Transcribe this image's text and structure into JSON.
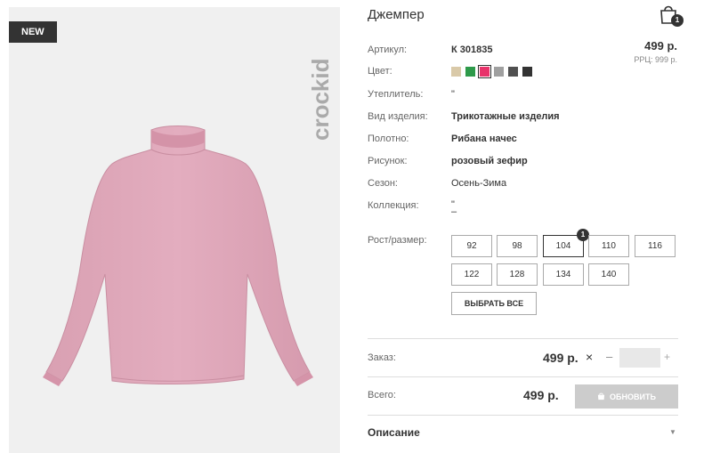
{
  "badge": "NEW",
  "brand": "crockid",
  "product": {
    "title": "Джемпер",
    "price": "499 р.",
    "rrp": "РРЦ: 999 р.",
    "cart_count": "1"
  },
  "attributes": {
    "article_label": "Артикул:",
    "article_value": "К 301835",
    "color_label": "Цвет:",
    "insulation_label": "Утеплитель:",
    "insulation_value": "\"",
    "type_label": "Вид изделия:",
    "type_value": "Трикотажные изделия",
    "fabric_label": "Полотно:",
    "fabric_value": "Рибана начес",
    "pattern_label": "Рисунок:",
    "pattern_value": "розовый зефир",
    "season_label": "Сезон:",
    "season_value": "Осень-Зима",
    "collection_label": "Коллекция:",
    "collection_value": "\"",
    "collection_value2": "–"
  },
  "colors": [
    "#d9c9a8",
    "#2e9a4a",
    "#e8336b",
    "#a0a0a0",
    "#505050",
    "#333333"
  ],
  "sizes": {
    "label": "Рост/размер:",
    "items": [
      "92",
      "98",
      "104",
      "110",
      "116",
      "122",
      "128",
      "134",
      "140"
    ],
    "selected_count": "1",
    "select_all": "ВЫБРАТЬ ВСЕ"
  },
  "order": {
    "label": "Заказ:",
    "price": "499 р.",
    "remove": "×",
    "minus": "–",
    "plus": "+"
  },
  "total": {
    "label": "Всего:",
    "price": "499 р.",
    "update_button": "ОБНОВИТЬ"
  },
  "description": {
    "label": "Описание",
    "caret": "▼"
  }
}
